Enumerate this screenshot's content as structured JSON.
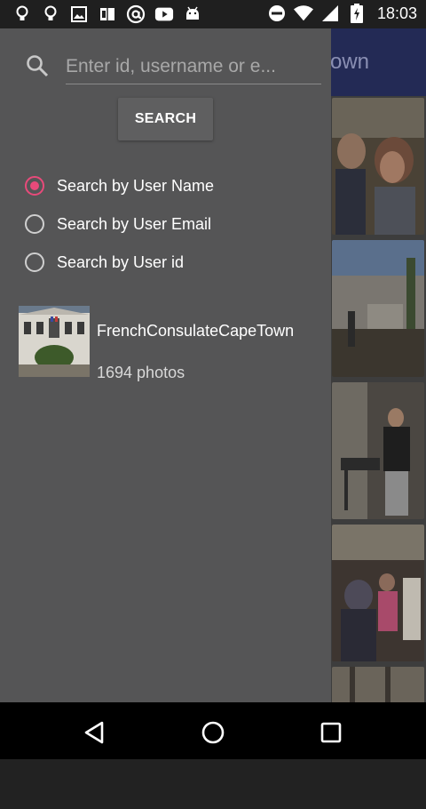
{
  "status_bar": {
    "time": "18:03",
    "left_icons": [
      "bulb-icon",
      "bulb-icon",
      "image-icon",
      "book-icon",
      "at-icon",
      "youtube-icon",
      "android-icon"
    ],
    "right_icons": [
      "do-not-disturb-icon",
      "wifi-icon",
      "signal-icon",
      "battery-charging-icon"
    ]
  },
  "background_app": {
    "title_partial": "own",
    "toolbar_color": "#232a55"
  },
  "drawer": {
    "search": {
      "placeholder": "Enter id, username or e..."
    },
    "search_button_label": "SEARCH",
    "radio_options": [
      {
        "label": "Search by User Name",
        "checked": true
      },
      {
        "label": "Search by User Email",
        "checked": false
      },
      {
        "label": "Search by User id",
        "checked": false
      }
    ],
    "result": {
      "name": "FrenchConsulateCapeTown",
      "count": "1694 photos"
    }
  },
  "colors": {
    "accent": "#e84a7a",
    "drawer_bg": "#555556"
  },
  "nav_bar": {
    "icons": [
      "back-icon",
      "home-icon",
      "recents-icon"
    ]
  }
}
